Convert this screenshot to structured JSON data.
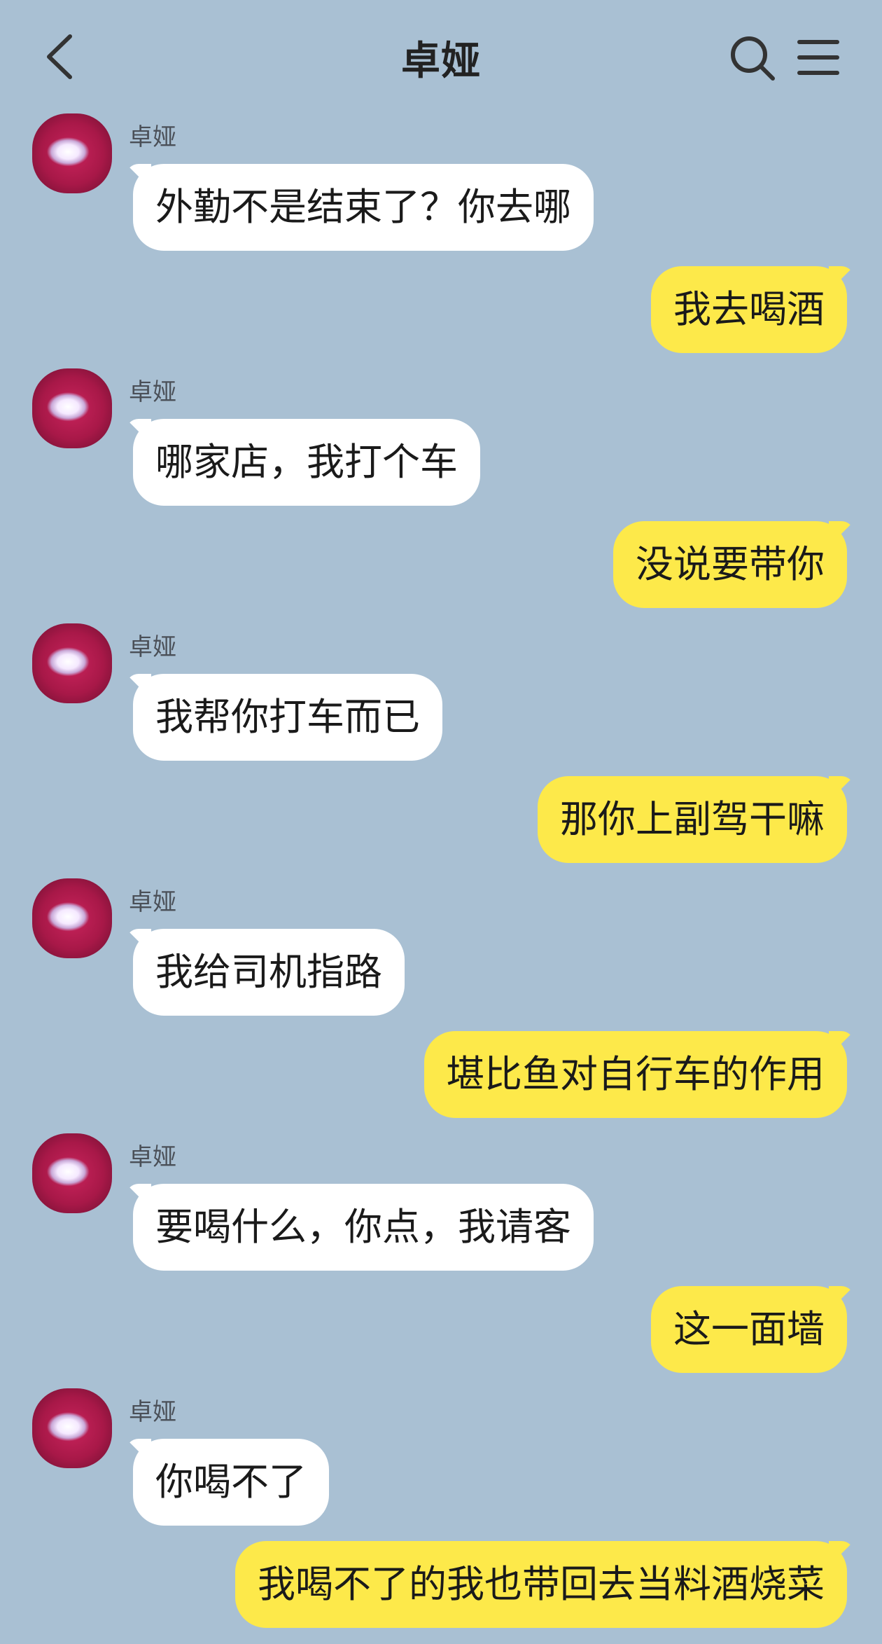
{
  "header": {
    "title": "卓娅",
    "back_icon": "chevron-left-icon",
    "search_icon": "search-icon",
    "menu_icon": "menu-icon"
  },
  "colors": {
    "background": "#a9c0d3",
    "incoming_bubble": "#ffffff",
    "outgoing_bubble": "#fde94a"
  },
  "messages": [
    {
      "direction": "in",
      "sender": "卓娅",
      "text": "外勤不是结束了？你去哪"
    },
    {
      "direction": "out",
      "text": "我去喝酒"
    },
    {
      "direction": "in",
      "sender": "卓娅",
      "text": "哪家店，我打个车"
    },
    {
      "direction": "out",
      "text": "没说要带你"
    },
    {
      "direction": "in",
      "sender": "卓娅",
      "text": "我帮你打车而已"
    },
    {
      "direction": "out",
      "text": "那你上副驾干嘛"
    },
    {
      "direction": "in",
      "sender": "卓娅",
      "text": "我给司机指路"
    },
    {
      "direction": "out",
      "text": "堪比鱼对自行车的作用"
    },
    {
      "direction": "in",
      "sender": "卓娅",
      "text": "要喝什么，你点，我请客"
    },
    {
      "direction": "out",
      "text": "这一面墙"
    },
    {
      "direction": "in",
      "sender": "卓娅",
      "text": "你喝不了"
    },
    {
      "direction": "out",
      "text": "我喝不了的我也带回去当料酒烧菜"
    }
  ]
}
